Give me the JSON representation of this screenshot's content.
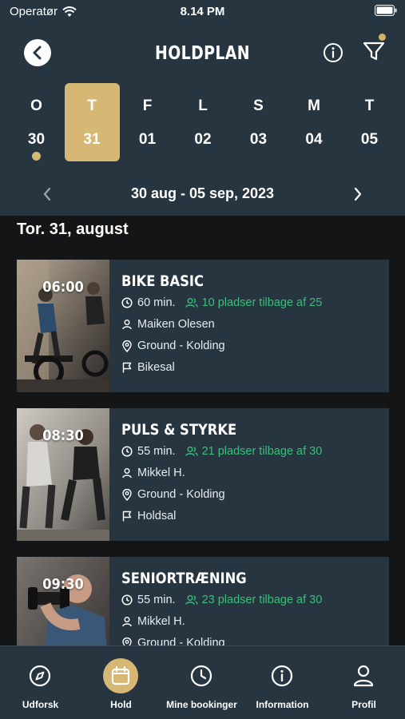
{
  "status_bar": {
    "carrier": "Operatør",
    "time": "8.14 PM"
  },
  "header": {
    "title": "HOLDPLAN"
  },
  "colors": {
    "header_bg": "#263540",
    "accent": "#d6b773",
    "seats_green": "#38c07a",
    "page_bg": "#141516"
  },
  "days": [
    {
      "letter": "O",
      "number": "30",
      "active": false,
      "has_dot": true
    },
    {
      "letter": "T",
      "number": "31",
      "active": true,
      "has_dot": false
    },
    {
      "letter": "F",
      "number": "01",
      "active": false,
      "has_dot": false
    },
    {
      "letter": "L",
      "number": "02",
      "active": false,
      "has_dot": false
    },
    {
      "letter": "S",
      "number": "03",
      "active": false,
      "has_dot": false
    },
    {
      "letter": "M",
      "number": "04",
      "active": false,
      "has_dot": false
    },
    {
      "letter": "T",
      "number": "05",
      "active": false,
      "has_dot": false
    }
  ],
  "range": {
    "text": "30 aug - 05 sep, 2023"
  },
  "date_heading": "Tor. 31, august",
  "classes": [
    {
      "time": "06:00",
      "title": "BIKE BASIC",
      "duration": "60 min.",
      "seats": "10 pladser tilbage af 25",
      "instructor": "Maiken Olesen",
      "location": "Ground - Kolding",
      "room": "Bikesal"
    },
    {
      "time": "08:30",
      "title": "PULS & STYRKE",
      "duration": "55 min.",
      "seats": "21 pladser tilbage af 30",
      "instructor": "Mikkel H.",
      "location": "Ground - Kolding",
      "room": "Holdsal"
    },
    {
      "time": "09:30",
      "title": "SENIORTRÆNING",
      "duration": "55 min.",
      "seats": "23 pladser tilbage af 30",
      "instructor": "Mikkel H.",
      "location": "Ground - Kolding",
      "room": ""
    }
  ],
  "tabs": [
    {
      "label": "Udforsk",
      "icon": "compass-icon",
      "active": false
    },
    {
      "label": "Hold",
      "icon": "calendar-icon",
      "active": true
    },
    {
      "label": "Mine bookinger",
      "icon": "clock-icon",
      "active": false
    },
    {
      "label": "Information",
      "icon": "info-icon",
      "active": false
    },
    {
      "label": "Profil",
      "icon": "user-icon",
      "active": false
    }
  ]
}
